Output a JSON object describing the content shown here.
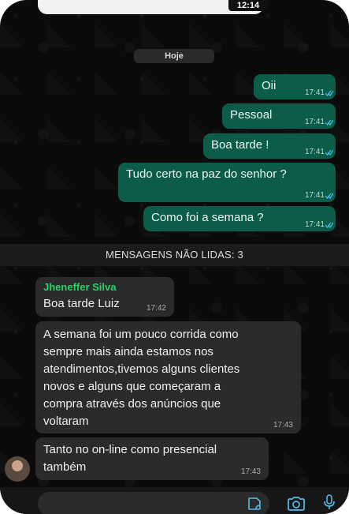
{
  "status_bar": {
    "time": "12:14"
  },
  "chat": {
    "date_divider": "Hoje",
    "outgoing": [
      {
        "text": "Oii",
        "time": "17:41"
      },
      {
        "text": "Pessoal",
        "time": "17:41"
      },
      {
        "text": "Boa tarde !",
        "time": "17:41"
      },
      {
        "text": "Tudo certo na paz do senhor ?",
        "time": "17:41"
      },
      {
        "text": "Como foi a semana ?",
        "time": "17:41"
      }
    ],
    "unread_divider": "MENSAGENS NÃO LIDAS: 3",
    "incoming": [
      {
        "sender": "Jheneffer Silva",
        "text": "Boa tarde Luiz",
        "time": "17:42"
      },
      {
        "text_lines": [
          "A semana foi um pouco corrida como",
          "sempre mais ainda estamos nos",
          "atendimentos,tivemos alguns clientes",
          "novos e alguns que começaram a",
          "compra através dos anúncios que",
          "voltaram"
        ],
        "time": "17:43"
      },
      {
        "text_lines": [
          "Tanto no on-line como presencial",
          "também"
        ],
        "time": "17:43"
      }
    ]
  },
  "colors": {
    "outgoing_bubble": "#0b5c48",
    "incoming_bubble": "#2b2b2b",
    "sender_name": "#25d366",
    "read_check": "#53bdeb"
  },
  "icons": [
    "sticker-icon",
    "camera-icon",
    "microphone-icon",
    "double-check-icon"
  ]
}
